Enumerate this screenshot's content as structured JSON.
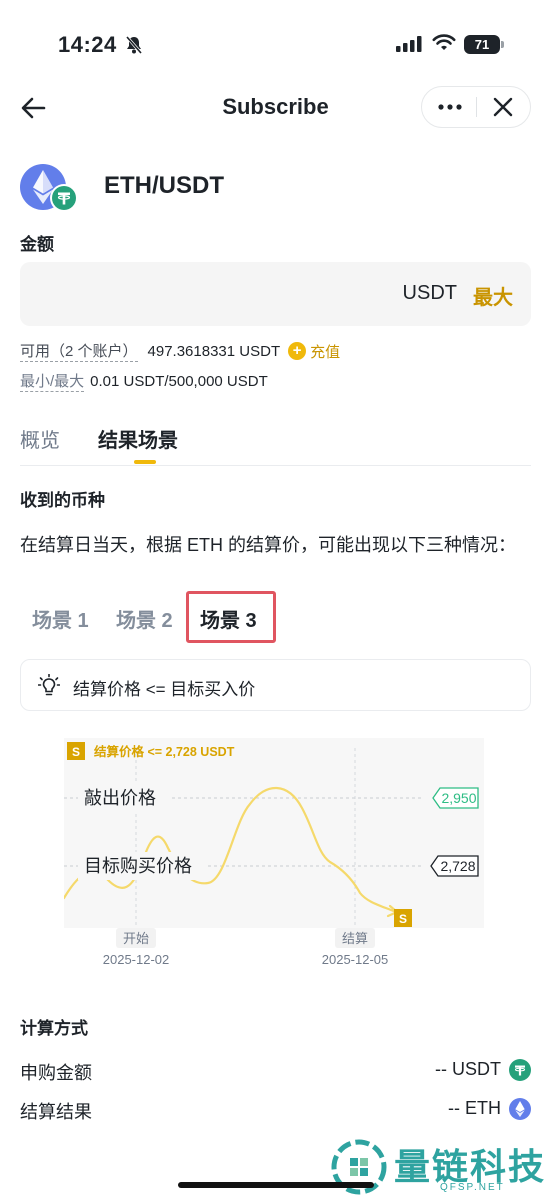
{
  "status_bar": {
    "time": "14:24",
    "battery": "71"
  },
  "nav": {
    "title": "Subscribe"
  },
  "pair": {
    "label": "ETH/USDT"
  },
  "amount": {
    "label": "金额",
    "unit": "USDT",
    "max_label": "最大"
  },
  "available": {
    "label": "可用（2 个账户）",
    "value": "497.3618331 USDT",
    "recharge": "充值",
    "minmax_label": "最小/最大",
    "minmax_value": "0.01 USDT/500,000 USDT"
  },
  "tabs": {
    "overview": "概览",
    "results": "结果场景"
  },
  "received": {
    "title": "收到的币种",
    "description": "在结算日当天，根据 ETH 的结算价，可能出现以下三种情况："
  },
  "scenarios": {
    "s1": "场景 1",
    "s2": "场景 2",
    "s3": "场景 3"
  },
  "condition": {
    "text": "结算价格 <= 目标买入价"
  },
  "chart": {
    "badge": "S",
    "legend": "结算价格 <= 2,728 USDT",
    "sell_label": "敲出价格",
    "sell_value": "2,950",
    "buy_label": "目标购买价格",
    "buy_value": "2,728",
    "start_label": "开始",
    "start_date": "2025-12-02",
    "end_label": "结算",
    "end_date": "2025-12-05",
    "line_color": "#f5d96b",
    "sell_color": "#2ebd85",
    "buy_color": "#1e2329",
    "badge_color": "#d9a400"
  },
  "calc": {
    "title": "计算方式",
    "subscribe_label": "申购金额",
    "subscribe_value": "-- USDT",
    "settle_label": "结算结果",
    "settle_value": "-- ETH"
  },
  "watermark": {
    "text": "量链科技",
    "sub": "QFSP.NET"
  },
  "colors": {
    "accent": "#f0b90b",
    "accent_text": "#c99400",
    "highlight_box": "#e05560"
  }
}
